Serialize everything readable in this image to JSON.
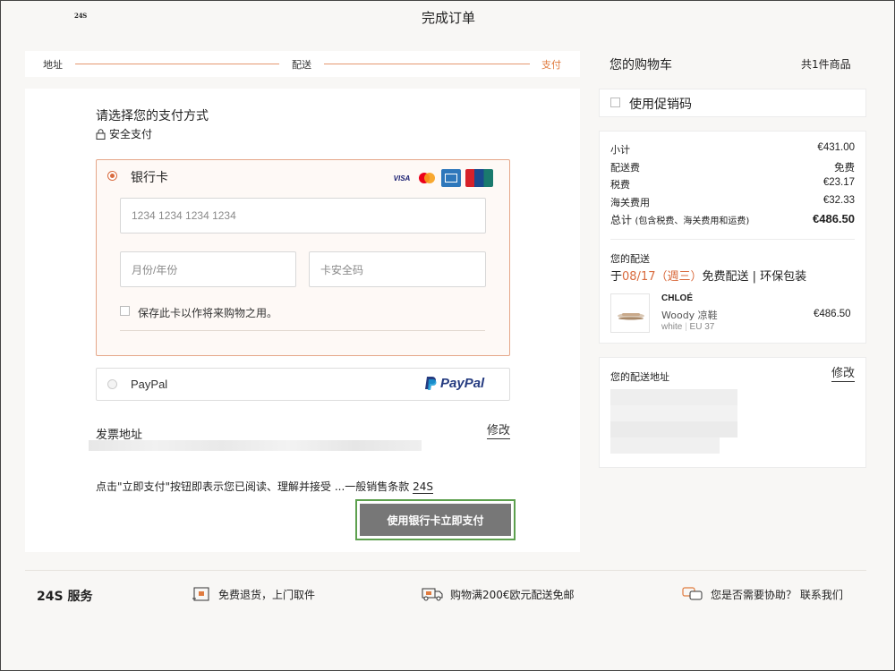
{
  "header": {
    "logo": "24S",
    "title": "完成订单"
  },
  "stepper": {
    "step1": "地址",
    "step2": "配送",
    "step3": "支付",
    "active_color": "#e07b3f"
  },
  "payment": {
    "title": "请选择您的支付方式",
    "secure": "安全支付",
    "card": {
      "label": "银行卡",
      "brands": [
        "VISA",
        "mastercard",
        "amex",
        "UnionPay"
      ],
      "number_placeholder": "1234 1234 1234 1234",
      "expiry_placeholder": "月份/年份",
      "cvc_placeholder": "卡安全码",
      "save_label": "保存此卡以作将来购物之用。"
    },
    "paypal": {
      "label": "PayPal",
      "logo_text": "PayPal"
    }
  },
  "billing": {
    "title": "发票地址",
    "edit": "修改"
  },
  "terms": {
    "text": "点击\"立即支付\"按钮即表示您已阅读、理解并接受 ...一般销售条款 ",
    "link": "24S"
  },
  "pay_button": "使用银行卡立即支付",
  "cart": {
    "title": "您的购物车",
    "count": "共1件商品",
    "promo": "使用促销码",
    "summary": [
      {
        "label": "小计",
        "value": "€431.00"
      },
      {
        "label": "配送费",
        "value": "免费"
      },
      {
        "label": "税费",
        "value": "€23.17"
      },
      {
        "label": "海关费用",
        "value": "€32.33"
      }
    ],
    "total": {
      "label": "总计",
      "note": "(包含税费、海关费用和运费)",
      "value": "€486.50"
    },
    "delivery": {
      "title": "您的配送",
      "prefix": "于",
      "date": "08/17（週三）",
      "rest": "免费配送 | 环保包装"
    },
    "product": {
      "brand": "CHLOÉ",
      "name": "Woody 凉鞋",
      "color": "white",
      "size": "EU 37",
      "price": "€486.50"
    },
    "shipping": {
      "title": "您的配送地址",
      "edit": "修改"
    }
  },
  "footer": {
    "title": "24S 服务",
    "items": [
      "免费退货，上门取件",
      "购物满200€欧元配送免邮",
      "您是否需要协助？ 联系我们"
    ]
  },
  "colors": {
    "accent": "#d96b3e",
    "button": "#777777",
    "focus_outline": "#5da04e"
  }
}
